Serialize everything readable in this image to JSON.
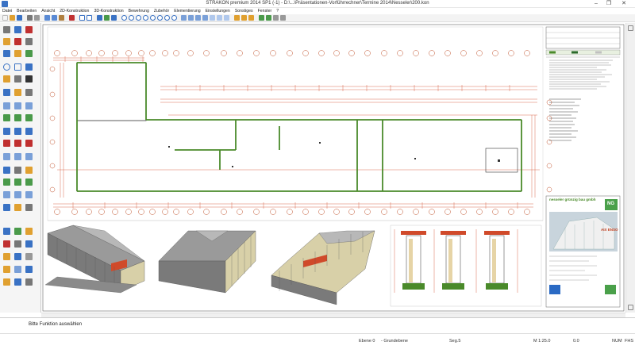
{
  "window": {
    "title": "STRAKON premium 2014 SP1 (-1)  - D:\\...\\Präsentationen-Vorführrechner\\Termine 2014\\Nesseler\\200.kon",
    "minimize_glyph": "–",
    "maximize_glyph": "❐",
    "close_glyph": "✕"
  },
  "menu": [
    "Datei",
    "Bearbeiten",
    "Ansicht",
    "2D-Konstruktion",
    "3D-Konstruktion",
    "Bewehrung",
    "Zubehör",
    "Elementierung",
    "Einstellungen",
    "Sonstiges",
    "Fenster",
    "?"
  ],
  "drawing": {
    "stamp_company": "nesseler grünzig bau gmbh",
    "stamp_project": "AIX ENSO",
    "stamp_logo": "NG"
  },
  "command_prompt": "Bitte Funktion auswählen",
  "status": {
    "layer": "Ebene 0",
    "plane": "- Grundebene",
    "segment": "Seg.5",
    "scale": "M 1:25.0",
    "offset": "0.0",
    "num": "NUM",
    "fhs": "FHS"
  },
  "colors": {
    "plan_red": "#d04a2a",
    "plan_green": "#4a8a2a",
    "toolbar_blue": "#3a72c4",
    "toolbar_orange": "#e0a030"
  }
}
